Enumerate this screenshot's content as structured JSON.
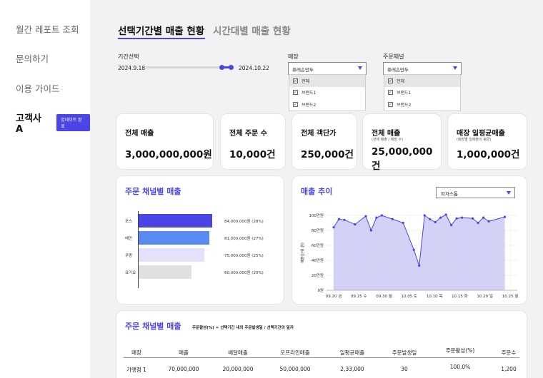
{
  "sidebar": {
    "items": [
      "월간 레포트 조회",
      "문의하기",
      "이용 가이드"
    ],
    "user_name": "고객사 A",
    "badge": "업데이트 완료"
  },
  "tabs": {
    "active": "선택기간별 매출 현황",
    "inactive": "시간대별 매출 현황"
  },
  "filters": {
    "period_label": "기간선택",
    "date_start": "2024.9.18",
    "date_end": "2024.10.22",
    "store": {
      "label": "매장",
      "selected": "퓨레손만두",
      "options": [
        "전체",
        "브랜드1",
        "브랜드2"
      ]
    },
    "channel": {
      "label": "주문채널",
      "selected": "퓨레손만두",
      "options": [
        "전체",
        "브랜드1",
        "브랜드2"
      ]
    }
  },
  "kpis": [
    {
      "title": "전체 매출",
      "sub": "",
      "value": "3,000,000,000원"
    },
    {
      "title": "전체 주문 수",
      "sub": "",
      "value": "10,000건"
    },
    {
      "title": "전체 객단가",
      "sub": "",
      "value": "250,000건"
    },
    {
      "title": "전체 매출",
      "sub": "(전체 매출 / 매장 수)",
      "value": "25,000,000건"
    },
    {
      "title": "매장 일평균매출",
      "sub": "(매장별 일매출의 평균)",
      "value": "1,000,000건"
    }
  ],
  "channel_panel": {
    "title": "주문 채널별 매출"
  },
  "trend_panel": {
    "title": "매출 추이",
    "select": "피자스톰"
  },
  "colors": {
    "accent": "#4b45e6",
    "bar1": "#4b45e6",
    "bar2": "#5a8bf0",
    "bar3": "#e4e2fb",
    "bar4": "#e0e0e0",
    "area": "#c9c6f5"
  },
  "chart_data": [
    {
      "type": "bar",
      "title": "주문 채널별 매출",
      "categories": [
        "포스",
        "배민",
        "쿠팡",
        "요기요"
      ],
      "values": [
        84000000,
        81000000,
        75000000,
        60000000
      ],
      "data_labels": [
        "84,000,000원 (28%)",
        "81,000,000원 (27%)",
        "75,000,000원 (25%)",
        "60,000,000원 (20%)"
      ],
      "orientation": "horizontal"
    },
    {
      "type": "area",
      "title": "매출 추이",
      "ylabel": "매출(단위:원)",
      "ylim": [
        0,
        100
      ],
      "yticks": [
        "0원",
        "20만원",
        "40만원",
        "60만원",
        "80만원",
        "100만원"
      ],
      "xticks": [
        "09.20 금",
        "09.25 수",
        "09.30 월",
        "10.05 토",
        "10.10 목",
        "10.15 화",
        "10.20 일",
        "10.25 월"
      ],
      "x": [
        "09.19",
        "09.20",
        "09.21",
        "09.22",
        "09.23",
        "09.24",
        "09.25",
        "09.26",
        "09.27",
        "09.28",
        "09.29",
        "09.30",
        "10.01",
        "10.02",
        "10.03",
        "10.04",
        "10.05",
        "10.06",
        "10.07",
        "10.08",
        "10.09",
        "10.10",
        "10.11",
        "10.12",
        "10.13",
        "10.14",
        "10.15",
        "10.16",
        "10.17",
        "10.18",
        "10.19",
        "10.20",
        "10.21",
        "10.22"
      ],
      "values": [
        84,
        95,
        94,
        null,
        88,
        null,
        99,
        80,
        97,
        100,
        null,
        95,
        null,
        90,
        null,
        54,
        33,
        100,
        95,
        91,
        97,
        101,
        87,
        96,
        97,
        null,
        96,
        90,
        97,
        92,
        null,
        null,
        98,
        null
      ],
      "grid": true
    }
  ],
  "table": {
    "title": "주문 채널별 매출",
    "note": "주문활성(%) = 선택기간 내의 주문발생일 / 선택기간의 일자",
    "headers": [
      "매장",
      "매출",
      "배달매출",
      "오프라인매출",
      "일평균매출",
      "주문발생일",
      "주문활성(%)",
      "주문수"
    ],
    "rows": [
      [
        "가맹점 1",
        "70,000,000",
        "20,000,000",
        "50,000,000",
        "2,33,000",
        "30",
        "100.0%",
        "1,200"
      ]
    ]
  }
}
